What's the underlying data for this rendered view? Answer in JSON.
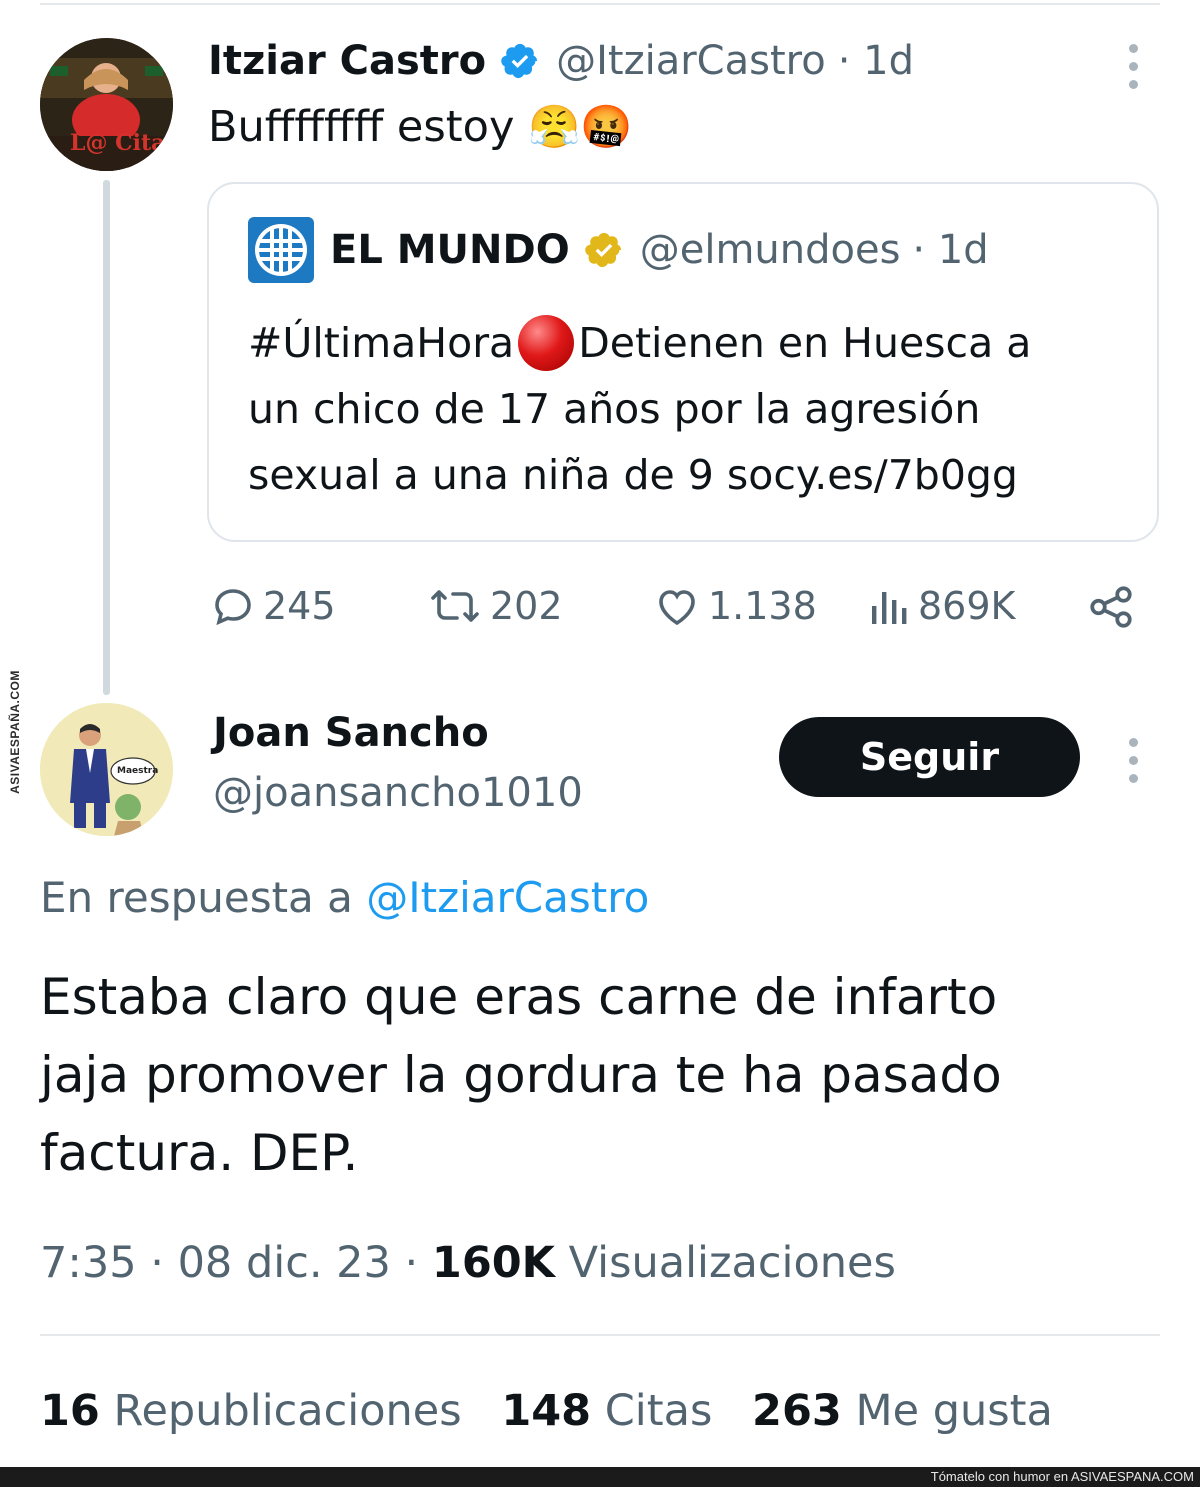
{
  "tweet": {
    "author_name": "Itziar Castro",
    "author_handle": "@ItziarCastro",
    "time": "· 1d",
    "text": "Buffffffff estoy",
    "emojis": "😤🤬",
    "avatar_caption": "L@ Cita",
    "quote": {
      "author_name": "EL MUNDO",
      "author_handle": "@elmundoes",
      "time": "· 1d",
      "text_line1_a": "#ÚltimaHora",
      "text_line1_b": "Detienen en Huesca a",
      "text_line2": "un chico de 17 años por la agresión",
      "text_line3": "sexual a una niña de 9 socy.es/7b0gg"
    },
    "actions": {
      "replies": "245",
      "retweets": "202",
      "likes": "1.138",
      "views": "869K"
    }
  },
  "reply": {
    "author_name": "Joan Sancho",
    "author_handle": "@joansancho1010",
    "follow_label": "Seguir",
    "avatar_caption": "Maestra",
    "in_reply_prefix": "En respuesta a",
    "in_reply_handle": "@ItziarCastro",
    "text_line1": "Estaba claro que eras carne de infarto",
    "text_line2": "jaja promover la gordura te ha pasado",
    "text_line3": "factura. DEP.",
    "meta_time": "7:35 · 08 dic. 23 ·",
    "meta_views_count": "160K",
    "meta_views_label": "Visualizaciones",
    "stats": {
      "reposts_count": "16",
      "reposts_label": "Republicaciones",
      "quotes_count": "148",
      "quotes_label": "Citas",
      "likes_count": "263",
      "likes_label": "Me gusta"
    }
  },
  "watermark": {
    "side_text": "ASIVAESPAÑA.COM",
    "bottom_text": "Tómatelo con humor en ASIVAESPANA.COM"
  },
  "colors": {
    "link": "#1d9bf0",
    "muted": "#536471",
    "verified_blue": "#1d9bf0",
    "verified_gold": "#e2b719",
    "follow_bg": "#0f1419"
  }
}
